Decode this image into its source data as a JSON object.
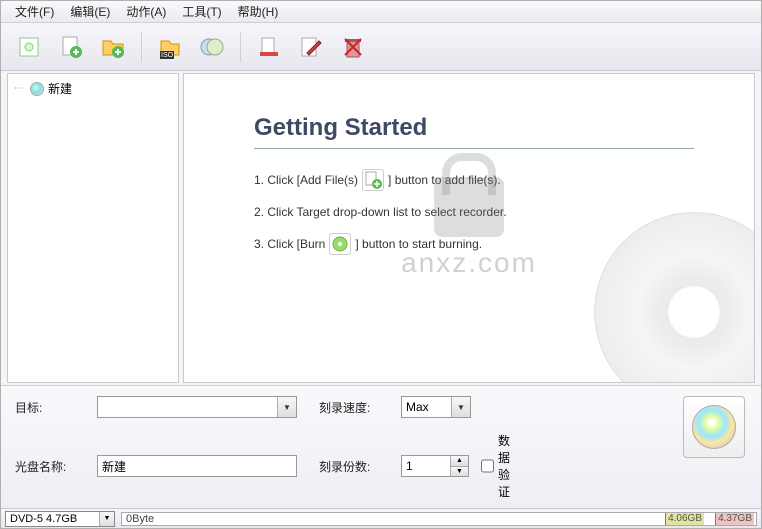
{
  "menu": {
    "file": "文件(F)",
    "edit": "编辑(E)",
    "action": "动作(A)",
    "tools": "工具(T)",
    "help": "帮助(H)"
  },
  "sidebar": {
    "root_label": "新建"
  },
  "getting_started": {
    "title": "Getting Started",
    "step1a": "1. Click [Add File(s)",
    "step1b": "] button to add file(s).",
    "step2": "2. Click Target drop-down list to select recorder.",
    "step3a": "3. Click [Burn",
    "step3b": "] button to start burning."
  },
  "watermark_text": "anxz.com",
  "controls": {
    "target_label": "目标:",
    "target_value": "",
    "disc_name_label": "光盘名称:",
    "disc_name_value": "新建",
    "speed_label": "刻录速度:",
    "speed_value": "Max",
    "copies_label": "刻录份数:",
    "copies_value": "1",
    "verify_label": "数据验证"
  },
  "status": {
    "media_type": "DVD-5 4.7GB",
    "current_size": "0Byte",
    "mark1": "4.06GB",
    "mark2": "4.37GB"
  }
}
